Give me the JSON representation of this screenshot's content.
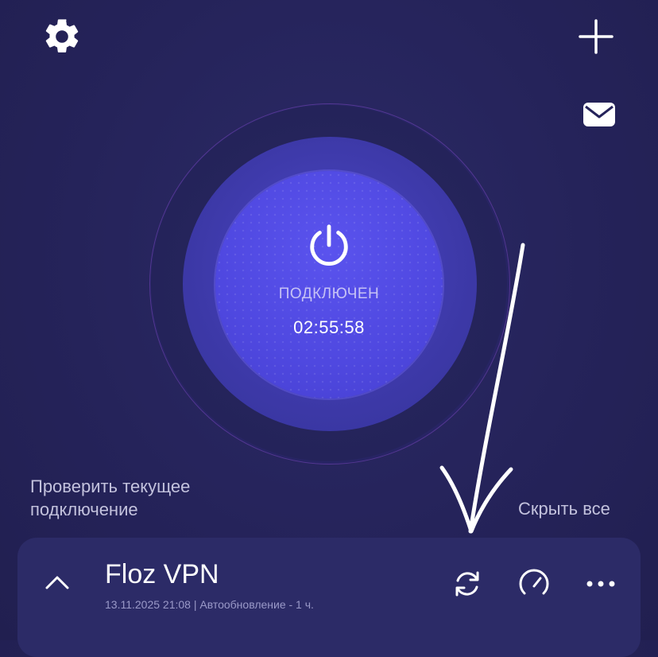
{
  "header": {
    "settings_icon": "gear-icon",
    "add_icon": "plus-icon",
    "mail_icon": "mail-icon"
  },
  "connection": {
    "status": "ПОДКЛЮЧЕН",
    "timer": "02:55:58",
    "power_icon": "power-icon"
  },
  "links": {
    "check": "Проверить текущее подключение",
    "hide_all": "Скрыть все"
  },
  "server_card": {
    "name": "Floz VPN",
    "meta": "13.11.2025 21:08 | Автообновление - 1 ч.",
    "icons": [
      "chevron-up-icon",
      "refresh-icon",
      "speedometer-icon",
      "more-icon"
    ]
  },
  "colors": {
    "background": "#25235a",
    "power_button": "#4f48e0",
    "card": "#2c2b67",
    "muted_text": "#c3c2dd"
  }
}
